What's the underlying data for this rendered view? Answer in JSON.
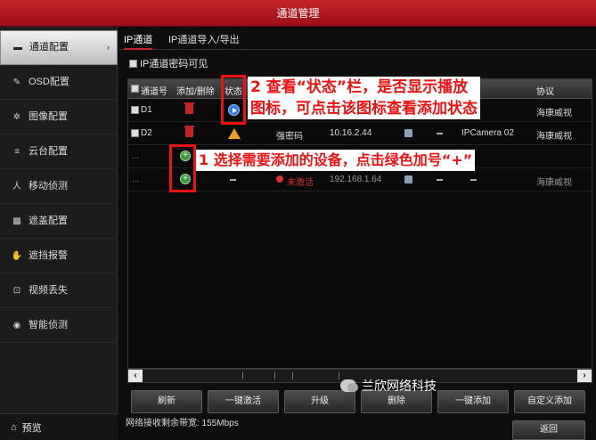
{
  "window": {
    "title": "通道管理"
  },
  "sidebar": {
    "items": [
      {
        "label": "通道配置",
        "icon": "camera-icon",
        "active": true
      },
      {
        "label": "OSD配置",
        "icon": "pencil-icon"
      },
      {
        "label": "图像配置",
        "icon": "aperture-icon"
      },
      {
        "label": "云台配置",
        "icon": "ptz-icon"
      },
      {
        "label": "移动侦测",
        "icon": "running-person-icon"
      },
      {
        "label": "遮盖配置",
        "icon": "mask-icon"
      },
      {
        "label": "遮挡报警",
        "icon": "hand-icon"
      },
      {
        "label": "视频丢失",
        "icon": "video-lost-icon"
      },
      {
        "label": "智能侦测",
        "icon": "smart-detect-icon"
      }
    ],
    "preview_label": "预览"
  },
  "tabs": [
    {
      "label": "IP通道",
      "active": true
    },
    {
      "label": "IP通道导入/导出",
      "active": false
    }
  ],
  "password_visible_label": "IP通道密码可见",
  "table": {
    "headers": [
      "通道号",
      "添加/删除",
      "状态",
      "协议"
    ],
    "rows": [
      {
        "channel": "D1",
        "action": "delete",
        "status": "play",
        "protocol": "海康威视"
      },
      {
        "channel": "D2",
        "action": "delete",
        "status": "warning",
        "security": "强密码",
        "ip": "10.16.2.44",
        "device_model": "IPCamera 02",
        "protocol": "海康威视"
      },
      {
        "channel": "...",
        "action": "add"
      },
      {
        "channel": "...",
        "action": "add",
        "security": "未激活",
        "ip": "192.168.1.64",
        "protocol": "海康威视"
      }
    ]
  },
  "buttons": [
    "刷新",
    "一键激活",
    "升级",
    "删除",
    "一键添加",
    "自定义添加"
  ],
  "bandwidth_text": "网络接收剩余带宽: 155Mbps",
  "return_label": "返回",
  "watermark": "兰欣网络科技",
  "annotations": {
    "callout_2_line1": "2 查看“状态”栏，是否显示播放",
    "callout_2_line2": "图标，可点击该图标查看添加状态",
    "callout_1": "1 选择需要添加的设备，点击绿色加号“+”"
  },
  "colors": {
    "accent_red": "#c4232a",
    "annotation_red": "#e11111",
    "add_green": "#3a9a3a",
    "play_blue": "#2f7fe0"
  }
}
